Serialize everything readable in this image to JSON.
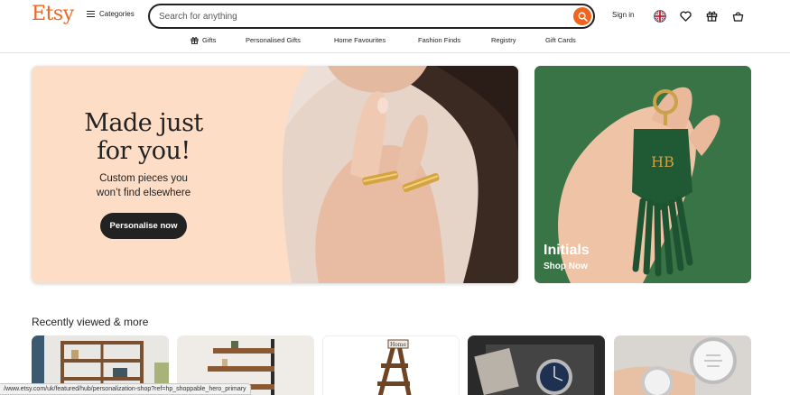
{
  "brand": {
    "logo": "Etsy",
    "accent": "#F1641E"
  },
  "header": {
    "categories_label": "Categories",
    "search_placeholder": "Search for anything",
    "search_value": "",
    "signin_label": "Sign in",
    "icons": [
      "uk-flag-icon",
      "heart-icon",
      "gift-icon",
      "basket-icon"
    ]
  },
  "nav": {
    "items": [
      {
        "label": "Gifts",
        "icon": "gift-icon"
      },
      {
        "label": "Personalised Gifts"
      },
      {
        "label": "Home Favourites"
      },
      {
        "label": "Fashion Finds"
      },
      {
        "label": "Registry"
      },
      {
        "label": "Gift Cards"
      }
    ]
  },
  "hero": {
    "title_line1": "Made just",
    "title_line2": "for you!",
    "subtitle_line1": "Custom pieces you",
    "subtitle_line2": "won’t find elsewhere",
    "button_label": "Personalise now",
    "background": "#FDDDC6"
  },
  "side_card": {
    "title": "Initials",
    "link": "Shop Now",
    "monogram": "HB",
    "background": "#3f7a4c"
  },
  "recently_viewed": {
    "title": "Recently viewed & more",
    "items": [
      {
        "name": "bookshelf"
      },
      {
        "name": "wall-shelves"
      },
      {
        "name": "ladder-shelf",
        "sign_text": "Home"
      },
      {
        "name": "watch-box"
      },
      {
        "name": "silver-watch"
      }
    ]
  },
  "status_bar": {
    "url": "/www.etsy.com/uk/featured/hub/personalization-shop?ref=hp_shoppable_hero_primary"
  }
}
